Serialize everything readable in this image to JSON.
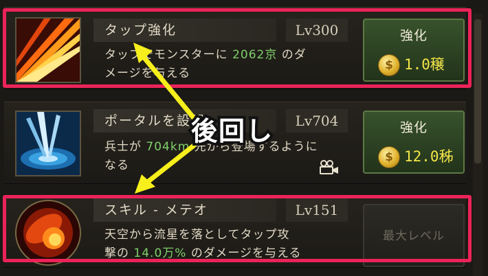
{
  "rows": [
    {
      "title": "タップ強化",
      "level": "Lv300",
      "desc_line1_pre": "タップでモンスターに",
      "desc_highlight": "2062京",
      "desc_line1_post": "のダ",
      "desc_line2": "メージを与える",
      "button_label": "強化",
      "button_cost": "1.0穣",
      "coin_symbol": "$",
      "icon": "tap-strike-icon"
    },
    {
      "title": "ポータルを設置",
      "level": "Lv704",
      "desc_line1_pre": "兵士が",
      "desc_highlight": "704km",
      "desc_line1_post": "先から登場するように",
      "desc_line2": "なる",
      "button_label": "強化",
      "button_cost": "12.0秭",
      "coin_symbol": "$",
      "icon": "portal-icon"
    },
    {
      "title": "スキル - メテオ",
      "level": "Lv151",
      "desc_line1": "天空から流星を落としてタップ攻",
      "desc_line2_pre": "撃の",
      "desc_highlight": "14.0万%",
      "desc_line2_post": "のダメージを与える",
      "button_label": "最大レベル",
      "icon": "meteor-icon"
    }
  ],
  "annotation": {
    "text": "後回し",
    "arrow_color": "#f6ef1c",
    "box_color": "#ec2359"
  }
}
